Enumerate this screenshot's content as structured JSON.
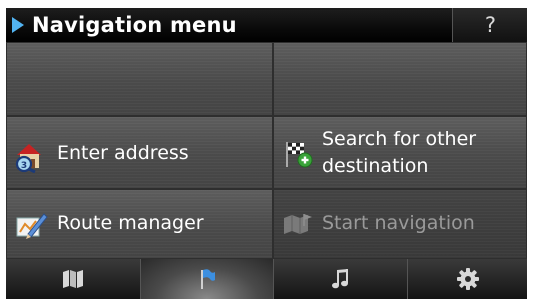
{
  "header": {
    "title": "Navigation menu",
    "help_label": "?"
  },
  "menu": {
    "enter_address": "Enter address",
    "search_other_line1": "Search for other",
    "search_other_line2": "destination",
    "route_manager": "Route manager",
    "start_navigation": "Start navigation"
  },
  "tabs": [
    {
      "icon": "map-icon"
    },
    {
      "icon": "flag-icon",
      "active": true
    },
    {
      "icon": "music-icon"
    },
    {
      "icon": "gear-icon"
    }
  ],
  "colors": {
    "accent": "#52b4f2",
    "background": "#4a4a4a",
    "disabled_text": "#9a9a9a"
  }
}
